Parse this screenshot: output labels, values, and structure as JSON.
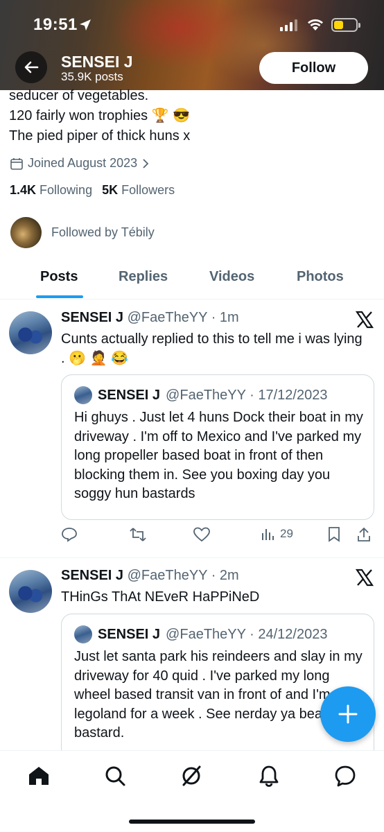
{
  "status_bar": {
    "time": "19:51"
  },
  "header": {
    "name": "SENSEI J",
    "posts_count": "35.9K posts",
    "follow_label": "Follow"
  },
  "bio": {
    "line1": "seducer of vegetables.",
    "line2": "120 fairly won trophies 🏆 😎",
    "line3": "The pied piper of thick huns x"
  },
  "joined": "Joined August 2023",
  "stats": {
    "following_count": "1.4K",
    "following_label": "Following",
    "followers_count": "5K",
    "followers_label": "Followers"
  },
  "followed_by": "Followed by Tébily",
  "tabs": [
    {
      "label": "Posts",
      "active": true
    },
    {
      "label": "Replies"
    },
    {
      "label": "Videos"
    },
    {
      "label": "Photos"
    }
  ],
  "tweets": [
    {
      "name": "SENSEI J",
      "handle_time": "@FaeTheYY · 1m",
      "text": "Cunts actually replied to this to tell me i was lying . 🫢 🤦 😂",
      "quote": {
        "name": "SENSEI J",
        "handle_time": "@FaeTheYY · 17/12/2023",
        "text": "Hi ghuys . Just let 4 huns Dock their boat in my driveway . I'm off to Mexico and I've parked my long propeller based boat in front of then blocking them in. See you boxing day you soggy hun bastards"
      },
      "views": "29"
    },
    {
      "name": "SENSEI J",
      "handle_time": "@FaeTheYY · 2m",
      "text": "THinGs ThAt NEveR HaPPiNeD",
      "quote": {
        "name": "SENSEI J",
        "handle_time": "@FaeTheYY · 24/12/2023",
        "text": "Just let santa park his reindeers and slay in my driveway for 40 quid . I've parked my long wheel based transit van in front of and I'm off to legoland for a week . See nerday ya beardy bastard."
      }
    }
  ],
  "colors": {
    "accent": "#1d9bf0",
    "text": "#0f1419",
    "muted": "#536471"
  }
}
